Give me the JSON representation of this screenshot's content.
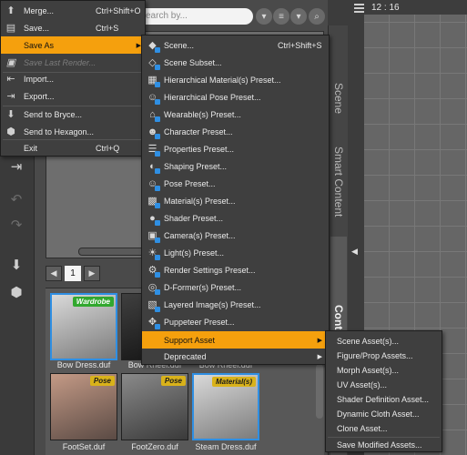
{
  "viewport": {
    "time": "12 : 16"
  },
  "search": {
    "placeholder": "earch by..."
  },
  "pager": {
    "page": "1"
  },
  "tabs": {
    "scene": "Scene",
    "smart_content": "Smart Content",
    "content_library": "Content Library"
  },
  "thumbnails": [
    {
      "caption": "Bow Dress.duf",
      "badge": "Wardrobe",
      "badge_color": "#31a82e"
    },
    {
      "caption": "Bow Rheel.duf",
      "badge": "",
      "badge_color": ""
    },
    {
      "caption": "Bow Rheel.duf",
      "badge": "",
      "badge_color": ""
    },
    {
      "caption": "FootSet.duf",
      "badge": "Pose",
      "badge_color": "#d9b21a"
    },
    {
      "caption": "FootZero.duf",
      "badge": "Pose",
      "badge_color": "#d9b21a"
    },
    {
      "caption": "Steam Dress.duf",
      "badge": "Material(s)",
      "badge_color": "#d9b21a"
    }
  ],
  "file_menu": {
    "items": [
      {
        "label": "Merge...",
        "shortcut": "Ctrl+Shift+O",
        "icon": "merge-icon"
      },
      {
        "label": "Save...",
        "shortcut": "Ctrl+S",
        "icon": "save-icon"
      },
      {
        "label": "Save As",
        "shortcut": "",
        "icon": ""
      },
      {
        "label": "Save Last Render...",
        "shortcut": "",
        "icon": "render-icon"
      },
      {
        "label": "Import...",
        "shortcut": "",
        "icon": "import-icon"
      },
      {
        "label": "Export...",
        "shortcut": "",
        "icon": "export-icon"
      },
      {
        "label": "Send to Bryce...",
        "shortcut": "",
        "icon": "bryce-icon"
      },
      {
        "label": "Send to Hexagon...",
        "shortcut": "",
        "icon": "hexagon-icon"
      },
      {
        "label": "Exit",
        "shortcut": "Ctrl+Q",
        "icon": ""
      }
    ]
  },
  "save_as_menu": {
    "items": [
      {
        "label": "Scene...",
        "shortcut": "Ctrl+Shift+S"
      },
      {
        "label": "Scene Subset...",
        "shortcut": ""
      },
      {
        "label": "Hierarchical Material(s) Preset...",
        "shortcut": ""
      },
      {
        "label": "Hierarchical Pose Preset...",
        "shortcut": ""
      },
      {
        "label": "Wearable(s) Preset...",
        "shortcut": ""
      },
      {
        "label": "Character Preset...",
        "shortcut": ""
      },
      {
        "label": "Properties Preset...",
        "shortcut": ""
      },
      {
        "label": "Shaping Preset...",
        "shortcut": ""
      },
      {
        "label": "Pose Preset...",
        "shortcut": ""
      },
      {
        "label": "Material(s) Preset...",
        "shortcut": ""
      },
      {
        "label": "Shader Preset...",
        "shortcut": ""
      },
      {
        "label": "Camera(s) Preset...",
        "shortcut": ""
      },
      {
        "label": "Light(s) Preset...",
        "shortcut": ""
      },
      {
        "label": "Render Settings Preset...",
        "shortcut": ""
      },
      {
        "label": "D-Former(s) Preset...",
        "shortcut": ""
      },
      {
        "label": "Layered Image(s) Preset...",
        "shortcut": ""
      },
      {
        "label": "Puppeteer Preset...",
        "shortcut": ""
      },
      {
        "label": "Support Asset",
        "shortcut": ""
      },
      {
        "label": "Deprecated",
        "shortcut": ""
      }
    ]
  },
  "support_asset_menu": {
    "items": [
      {
        "label": "Scene Asset(s)..."
      },
      {
        "label": "Figure/Prop Assets..."
      },
      {
        "label": "Morph Asset(s)..."
      },
      {
        "label": "UV Asset(s)..."
      },
      {
        "label": "Shader Definition Asset..."
      },
      {
        "label": "Dynamic Cloth Asset..."
      },
      {
        "label": "Clone Asset..."
      },
      {
        "label": "Save Modified Assets..."
      }
    ]
  },
  "colors": {
    "highlight": "#f5a00d",
    "menu_bg": "#3f3f3f",
    "selection_border": "#2f8fe3"
  }
}
